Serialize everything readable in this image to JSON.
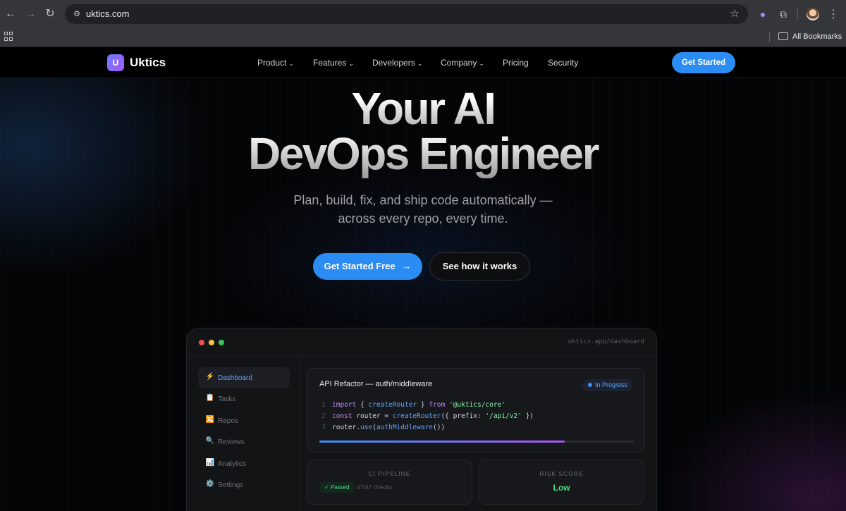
{
  "browser": {
    "url": "uktics.com",
    "bookmarks_label": "All Bookmarks",
    "icons": [
      "back-icon",
      "forward-icon",
      "reload-icon",
      "site-settings-icon",
      "star-icon",
      "extension-ghost-icon",
      "puzzle-icon",
      "avatar",
      "kebab-icon",
      "apps-grid-icon",
      "folder-icon"
    ]
  },
  "nav": {
    "brand_initial": "U",
    "brand": "Uktics",
    "items": [
      {
        "label": "Product",
        "dropdown": true
      },
      {
        "label": "Features",
        "dropdown": true
      },
      {
        "label": "Developers",
        "dropdown": true
      },
      {
        "label": "Company",
        "dropdown": true
      },
      {
        "label": "Pricing",
        "dropdown": false
      },
      {
        "label": "Security",
        "dropdown": false
      }
    ],
    "cta": "Get Started"
  },
  "hero": {
    "title_line1": "Your AI",
    "title_line2": "DevOps Engineer",
    "subtitle_line1": "Plan, build, fix, and ship code automatically —",
    "subtitle_line2": "across every repo, every time.",
    "primary_cta": "Get Started Free",
    "primary_cta_icon": "→",
    "secondary_cta": "See how it works"
  },
  "mock": {
    "url": "uktics.app/dashboard",
    "sidebar": [
      {
        "icon": "⚡",
        "label": "Dashboard",
        "active": true
      },
      {
        "icon": "📋",
        "label": "Tasks",
        "active": false
      },
      {
        "icon": "🔀",
        "label": "Repos",
        "active": false
      },
      {
        "icon": "🔍",
        "label": "Reviews",
        "active": false
      },
      {
        "icon": "📊",
        "label": "Analytics",
        "active": false
      },
      {
        "icon": "⚙️",
        "label": "Settings",
        "active": false
      }
    ],
    "task": {
      "title": "API Refactor — auth/middleware",
      "status": "In Progress",
      "progress": 0.78,
      "code": [
        {
          "n": "1",
          "text": "import { createRouter } from '@uktics/core'"
        },
        {
          "n": "2",
          "text": "const router = createRouter({ prefix: '/api/v2' })"
        },
        {
          "n": "3",
          "text": "router.use(authMiddleware())"
        }
      ]
    },
    "ci": {
      "label": "CI PIPELINE",
      "badge": "✓ Passed",
      "detail": "47/47 checks"
    },
    "risk": {
      "label": "RISK SCORE",
      "value": "Low"
    }
  },
  "colors": {
    "accent": "#2b8cf3",
    "success": "#4ade80",
    "brand_gradient": [
      "#6b7cff",
      "#a855f7"
    ]
  }
}
